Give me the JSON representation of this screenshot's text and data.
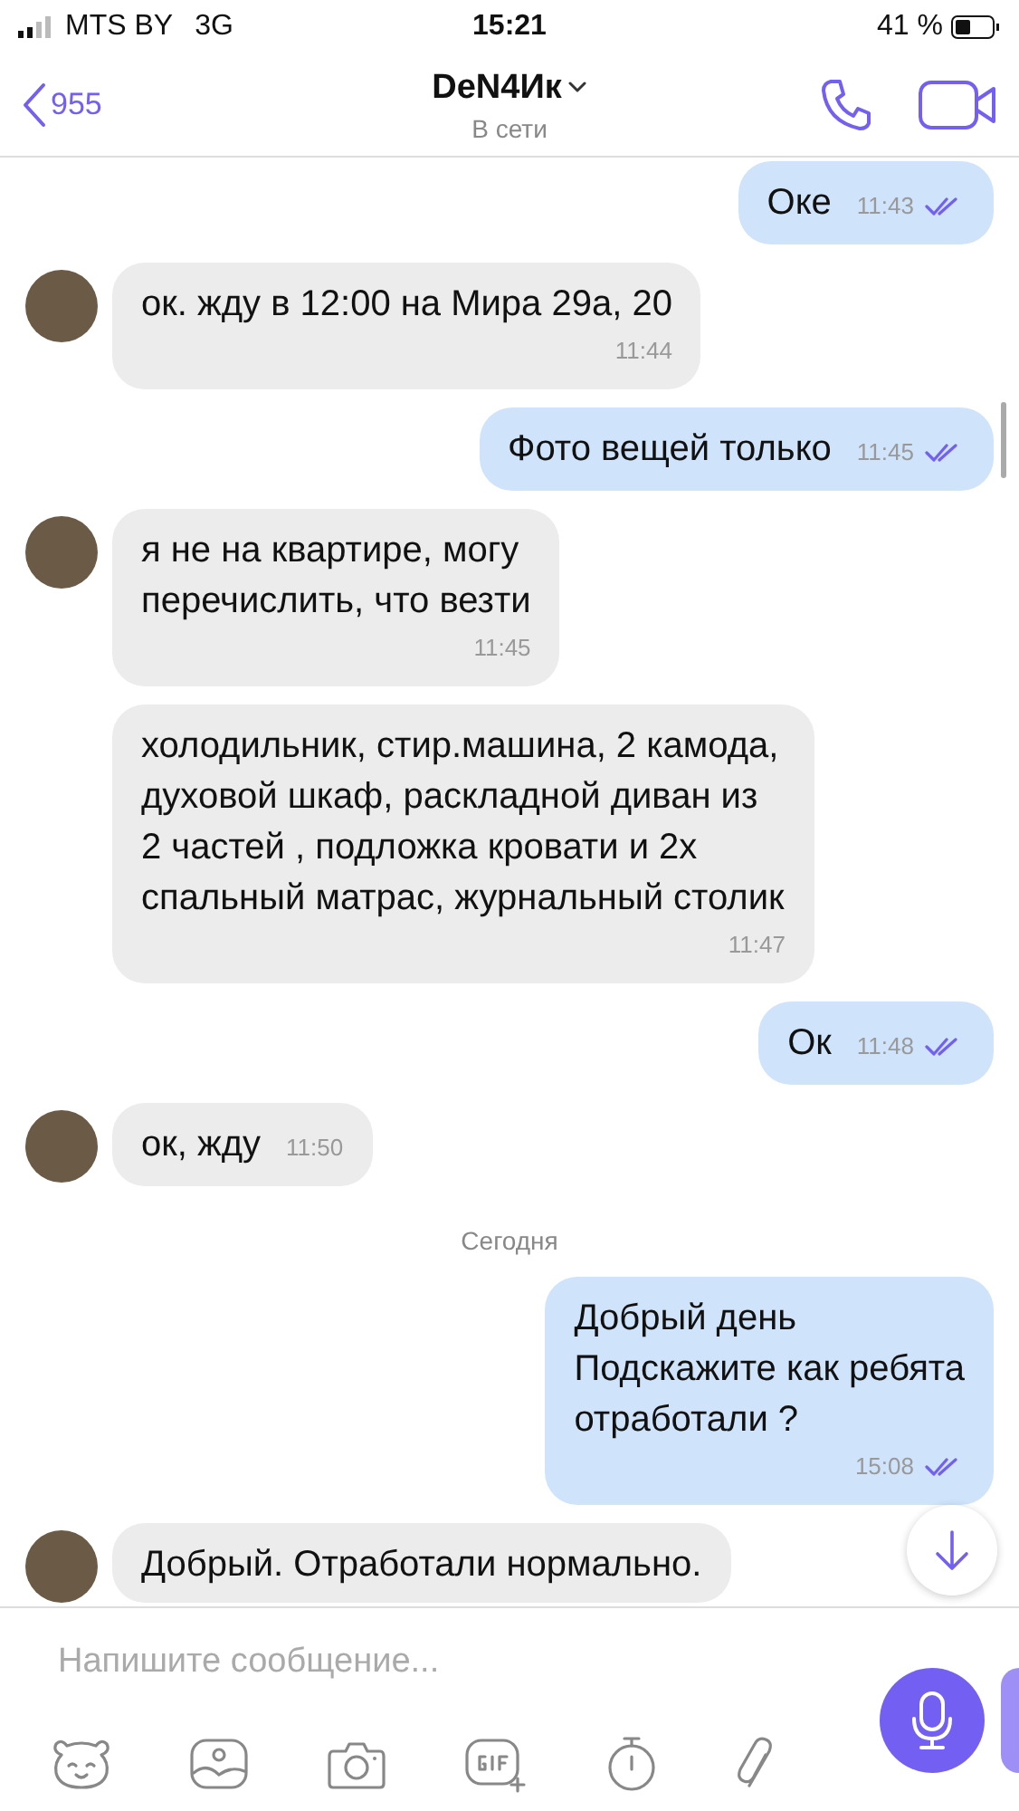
{
  "status_bar": {
    "carrier": "MTS BY",
    "network": "3G",
    "time": "15:21",
    "battery_percent": "41 %"
  },
  "header": {
    "back_count": "955",
    "contact_name": "DeN4Ик",
    "status": "В сети"
  },
  "messages": [
    {
      "kind": "out",
      "text": "Оке",
      "time": "11:43",
      "time_inline": true,
      "read": true
    },
    {
      "kind": "in",
      "avatar": true,
      "text": "ок. жду в 12:00 на Мира 29а, 20",
      "time": "11:44",
      "time_inline": false
    },
    {
      "kind": "out",
      "text": "Фото вещей только",
      "time": "11:45",
      "time_inline": true,
      "read": true
    },
    {
      "kind": "in",
      "avatar": true,
      "text": "я не на квартире, могу\nперечислить, что везти",
      "time": "11:45",
      "time_inline": false
    },
    {
      "kind": "in",
      "avatar": false,
      "text": "холодильник, стир.машина, 2 камода, духовой шкаф, раскладной диван из 2 частей , подложка кровати и 2х спальный матрас, журнальный столик",
      "time": "11:47",
      "time_inline": false
    },
    {
      "kind": "out",
      "text": "Ок",
      "time": "11:48",
      "time_inline": true,
      "read": true
    },
    {
      "kind": "in",
      "avatar": true,
      "text": "ок, жду",
      "time": "11:50",
      "time_inline": true
    },
    {
      "kind": "date",
      "text": "Сегодня"
    },
    {
      "kind": "out",
      "text": "Добрый день\nПодскажите как ребята\nотработали ?",
      "time": "15:08",
      "time_inline": false,
      "read": true
    },
    {
      "kind": "in",
      "avatar": true,
      "text": "Добрый. Отработали нормально.",
      "time_inline": false
    }
  ],
  "composer": {
    "placeholder": "Напишите сообщение..."
  }
}
